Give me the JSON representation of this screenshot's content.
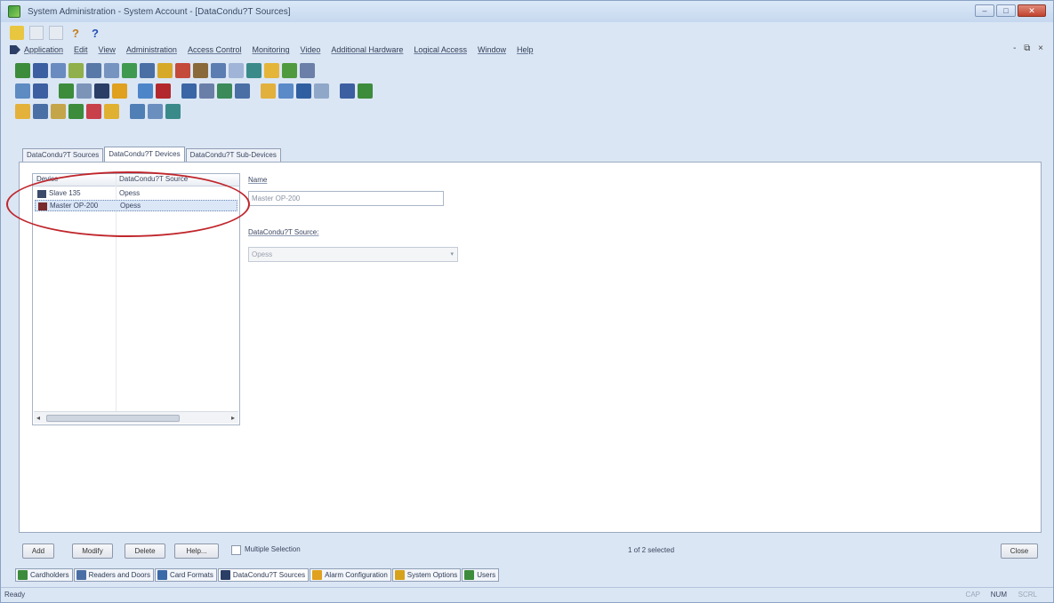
{
  "window": {
    "title": "System Administration - System Account - [DataCondu?T Sources]",
    "controls": [
      "–",
      "□",
      "✕"
    ]
  },
  "quick_access": [
    "?",
    "?",
    "?",
    "?",
    "?"
  ],
  "menu": {
    "items": [
      "Application",
      "Edit",
      "View",
      "Administration",
      "Access Control",
      "Monitoring",
      "Video",
      "Additional Hardware",
      "Logical Access",
      "Window",
      "Help"
    ],
    "mdi_controls": "- ⧉ ×"
  },
  "tabs": [
    "DataCondu?T Sources",
    "DataCondu?T Devices",
    "DataCondu?T Sub-Devices"
  ],
  "device_list": {
    "columns": [
      "Device",
      "DataCondu?T Source"
    ],
    "rows": [
      {
        "device": "Slave 135",
        "source": "Opess"
      },
      {
        "device": "Master OP-200",
        "source": "Opess"
      }
    ],
    "scroll_left": "◂",
    "scroll_right": "▸"
  },
  "form": {
    "name_label": "Name",
    "name_value": "Master OP-200",
    "source_label": "DataCondu?T Source:",
    "source_value": "Opess",
    "source_arrow": "▾"
  },
  "buttons": {
    "add": "Add",
    "modify": "Modify",
    "delete": "Delete",
    "help": "Help...",
    "close": "Close"
  },
  "multiple_selection_label": "Multiple Selection",
  "selection_status": "1 of 2 selected",
  "taskbar": [
    {
      "label": "Cardholders",
      "color": "#3c8c3c"
    },
    {
      "label": "Readers and Doors",
      "color": "#4a6fa5"
    },
    {
      "label": "Card Formats",
      "color": "#3a6aa8"
    },
    {
      "label": "DataCondu?T Sources",
      "color": "#2a3e66"
    },
    {
      "label": "Alarm Configuration",
      "color": "#e0a020"
    },
    {
      "label": "System Options",
      "color": "#d6a21c"
    },
    {
      "label": "Users",
      "color": "#3c8c3c"
    }
  ],
  "status": {
    "text": "Ready",
    "caps": "CAP",
    "num": "NUM",
    "scrl": "SCRL"
  },
  "colors": {
    "annotation": "#c0262c",
    "chrome": "#dbe6f4",
    "accent": "#4a6fa5"
  }
}
